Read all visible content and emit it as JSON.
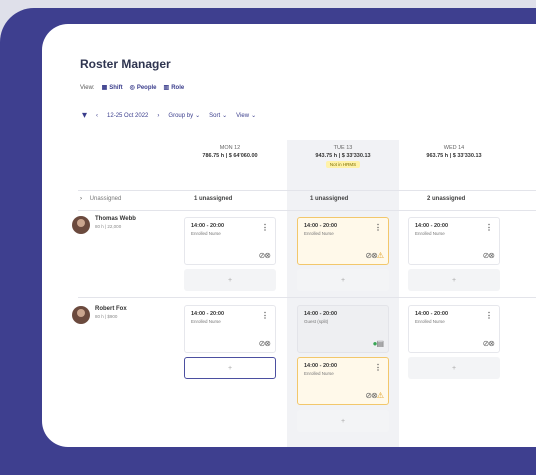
{
  "app": {
    "title": "Roster Manager"
  },
  "view": {
    "label": "View:",
    "options": [
      {
        "icon": "calendar-icon",
        "label": "Shift"
      },
      {
        "icon": "people-icon",
        "label": "People"
      },
      {
        "icon": "role-icon",
        "label": "Role"
      }
    ]
  },
  "toolbar": {
    "prev": "‹",
    "date_range": "12-25 Oct 2022",
    "next": "›",
    "group_by": "Group by",
    "sort": "Sort",
    "view": "View",
    "chevron": "⌄"
  },
  "days": [
    {
      "day": "MON 12",
      "summary": "786.75 h | $ 64'060.00",
      "badge": ""
    },
    {
      "day": "TUE 13",
      "summary": "943.75 h | $ 33'330.13",
      "badge": "Not in HRMS"
    },
    {
      "day": "WED 14",
      "summary": "963.75 h | $ 33'330.13",
      "badge": ""
    }
  ],
  "unassigned": {
    "toggle": "›",
    "label": "Unassigned",
    "counts": [
      "1 unassigned",
      "1 unassigned",
      "2 unassigned"
    ]
  },
  "people": [
    {
      "name": "Thomas Webb",
      "meta": "80 h | 22,000"
    },
    {
      "name": "Robert Fox",
      "meta": "80 h | $900"
    }
  ],
  "shifts": {
    "tw_mon": {
      "time": "14:00 - 20:00",
      "role": "Enrolled Nurse"
    },
    "tw_tue": {
      "time": "14:00 - 20:00",
      "role": "Enrolled Nurse"
    },
    "tw_wed": {
      "time": "14:00 - 20:00",
      "role": "Enrolled Nurse"
    },
    "rf_mon": {
      "time": "14:00 - 20:00",
      "role": "Enrolled Nurse"
    },
    "rf_tue1": {
      "time": "14:00 - 20:00",
      "role": "Guest (split)"
    },
    "rf_tue2": {
      "time": "14:00 - 20:00",
      "role": "Enrolled Nurse"
    },
    "rf_wed": {
      "time": "14:00 - 20:00",
      "role": "Enrolled Nurse"
    }
  },
  "glyphs": {
    "menu": "⋮",
    "add": "+",
    "status": "⊘⊗",
    "warn": "⚠",
    "ok": "●",
    "note": "▤",
    "edit": "✎"
  },
  "colors": {
    "frame": "#3e3f8f",
    "accent": "#3a3d8c",
    "warning": "#f2c76b",
    "ok": "#3aa656"
  }
}
